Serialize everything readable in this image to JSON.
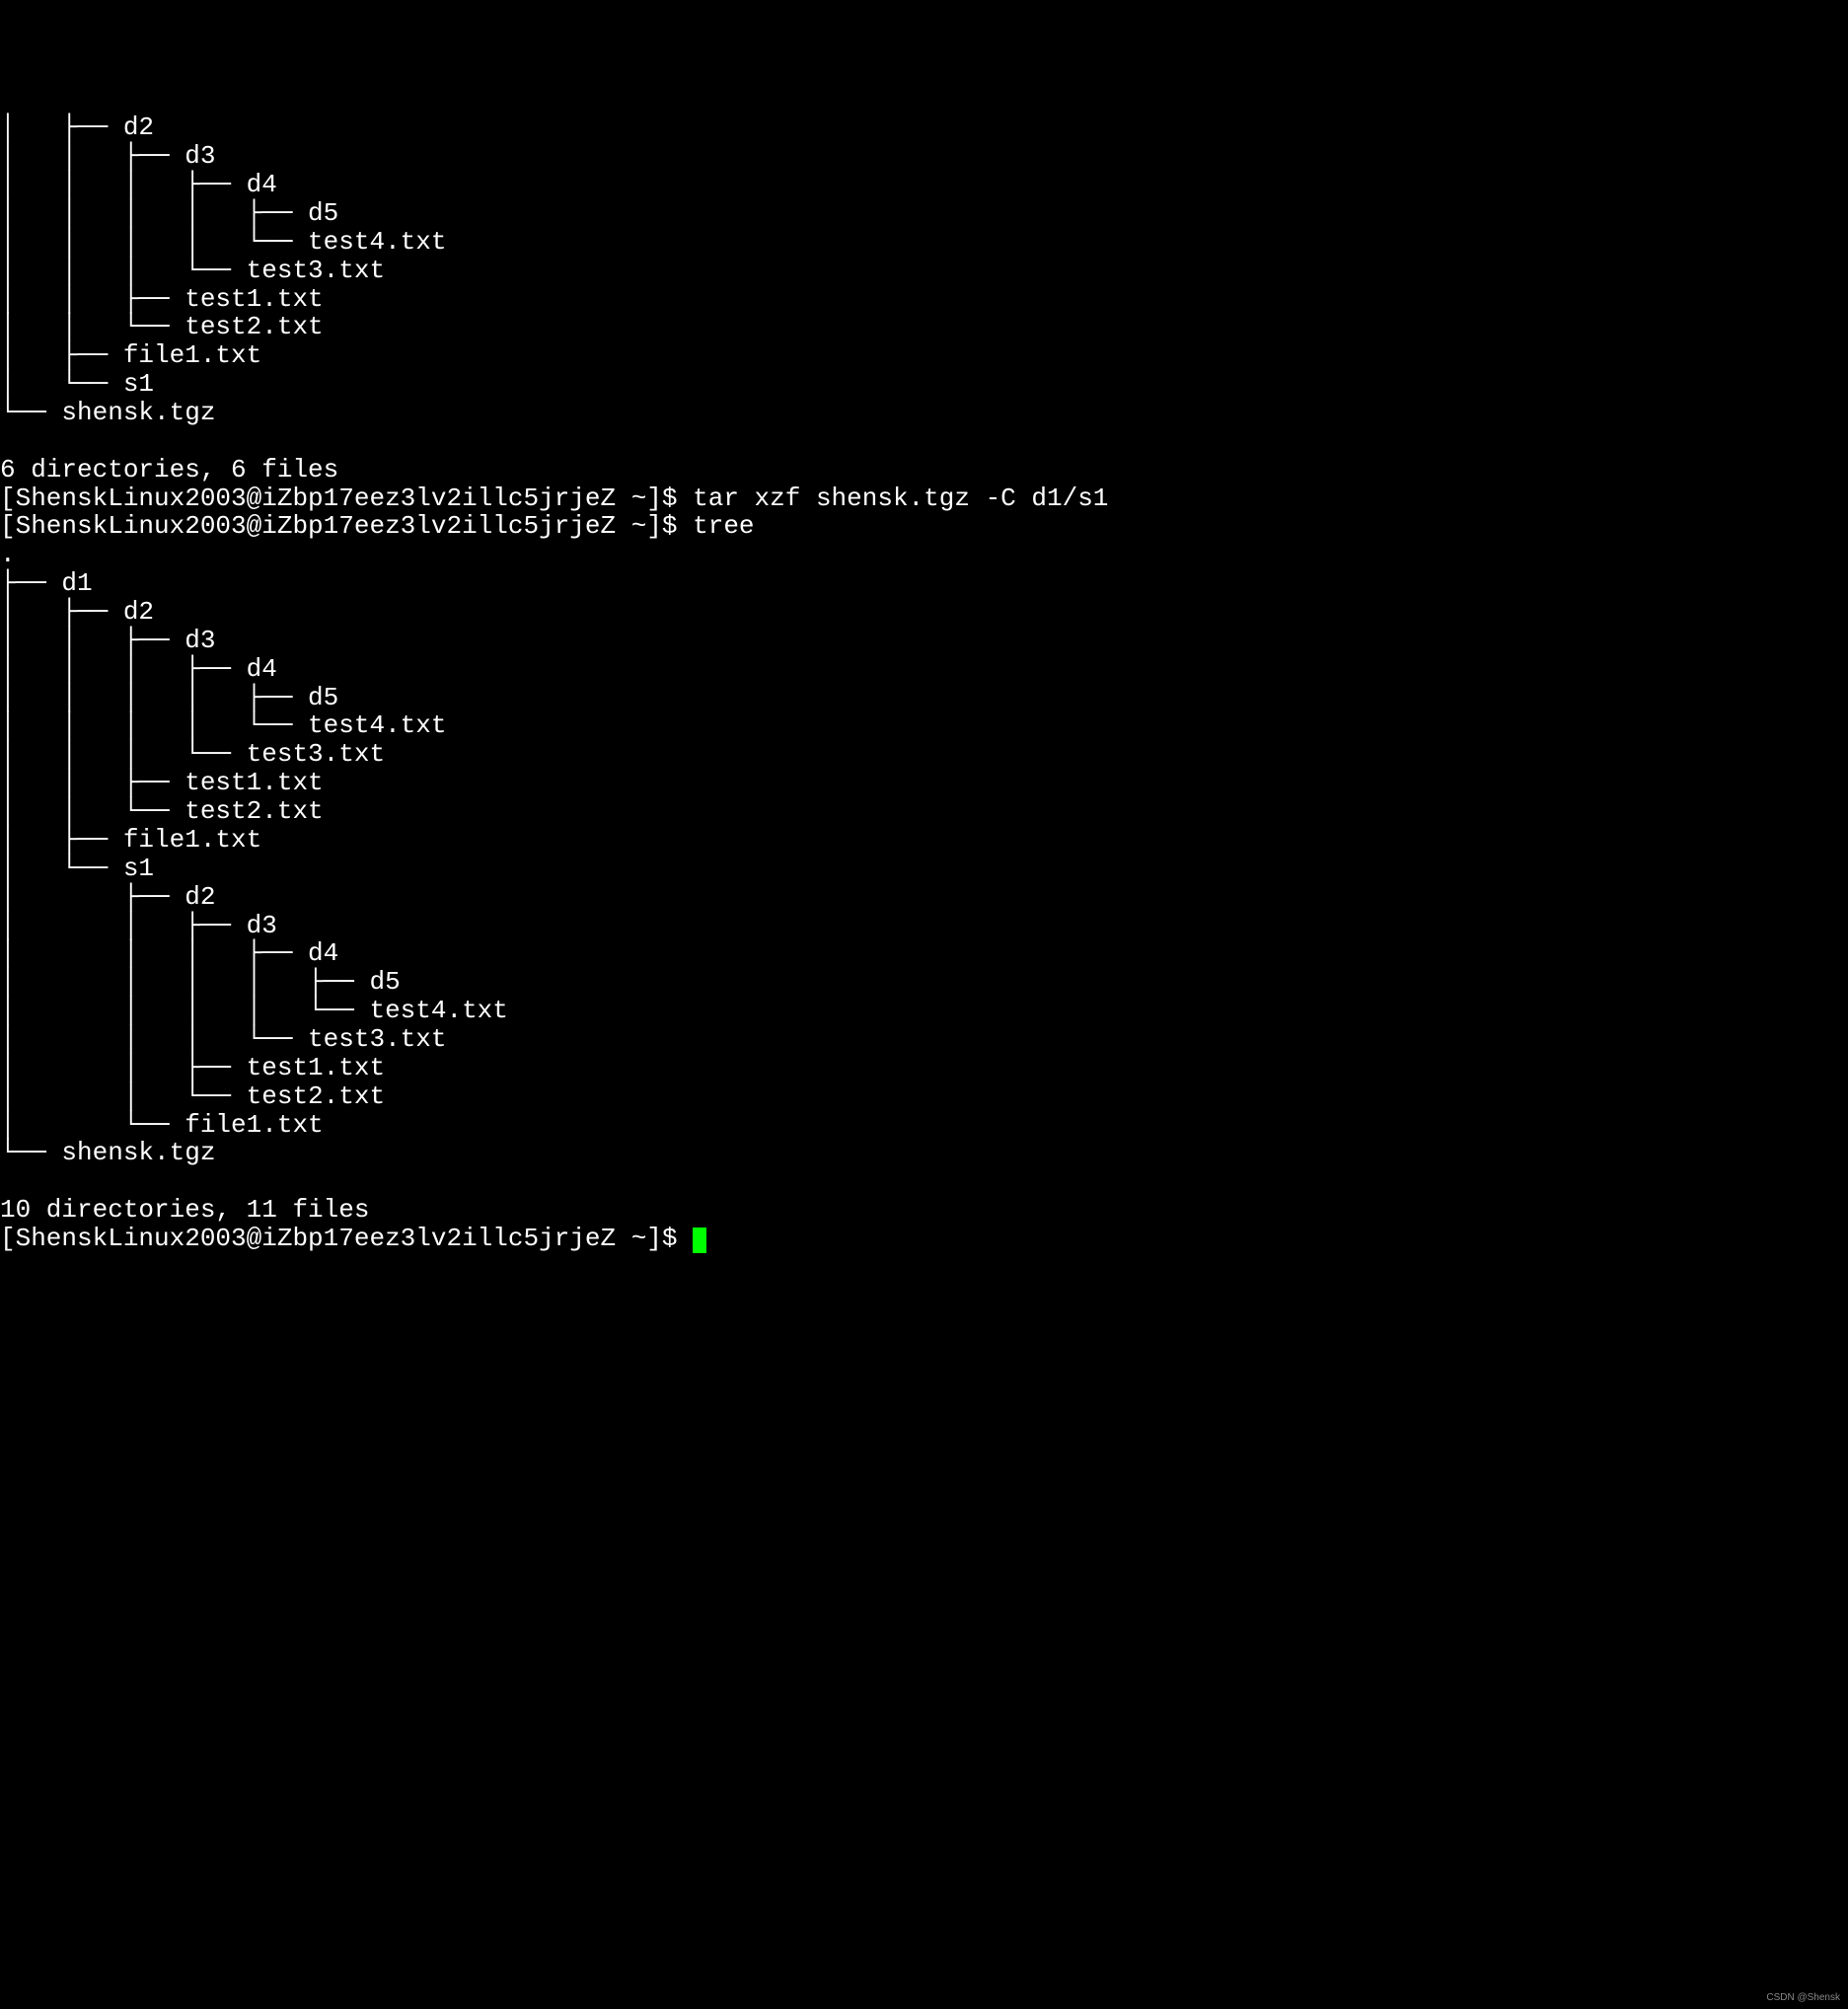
{
  "lines": [
    "│   ├── d2",
    "│   │   ├── d3",
    "│   │   │   ├── d4",
    "│   │   │   │   ├── d5",
    "│   │   │   │   └── test4.txt",
    "│   │   │   └── test3.txt",
    "│   │   ├── test1.txt",
    "│   │   └── test2.txt",
    "│   ├── file1.txt",
    "│   └── s1",
    "└── shensk.tgz",
    "",
    "6 directories, 6 files"
  ],
  "prompt1": {
    "prefix": "[ShenskLinux2003@iZbp17eez3lv2illc5jrjeZ ~]$ ",
    "command": "tar xzf shensk.tgz -C d1/s1"
  },
  "prompt2": {
    "prefix": "[ShenskLinux2003@iZbp17eez3lv2illc5jrjeZ ~]$ ",
    "command": "tree"
  },
  "lines2": [
    ".",
    "├── d1",
    "│   ├── d2",
    "│   │   ├── d3",
    "│   │   │   ├── d4",
    "│   │   │   │   ├── d5",
    "│   │   │   │   └── test4.txt",
    "│   │   │   └── test3.txt",
    "│   │   ├── test1.txt",
    "│   │   └── test2.txt",
    "│   ├── file1.txt",
    "│   └── s1",
    "│       ├── d2",
    "│       │   ├── d3",
    "│       │   │   ├── d4",
    "│       │   │   │   ├── d5",
    "│       │   │   │   └── test4.txt",
    "│       │   │   └── test3.txt",
    "│       │   ├── test1.txt",
    "│       │   └── test2.txt",
    "│       └── file1.txt",
    "└── shensk.tgz",
    "",
    "10 directories, 11 files"
  ],
  "prompt3": {
    "prefix": "[ShenskLinux2003@iZbp17eez3lv2illc5jrjeZ ~]$ "
  },
  "watermark": "CSDN @Shensk"
}
